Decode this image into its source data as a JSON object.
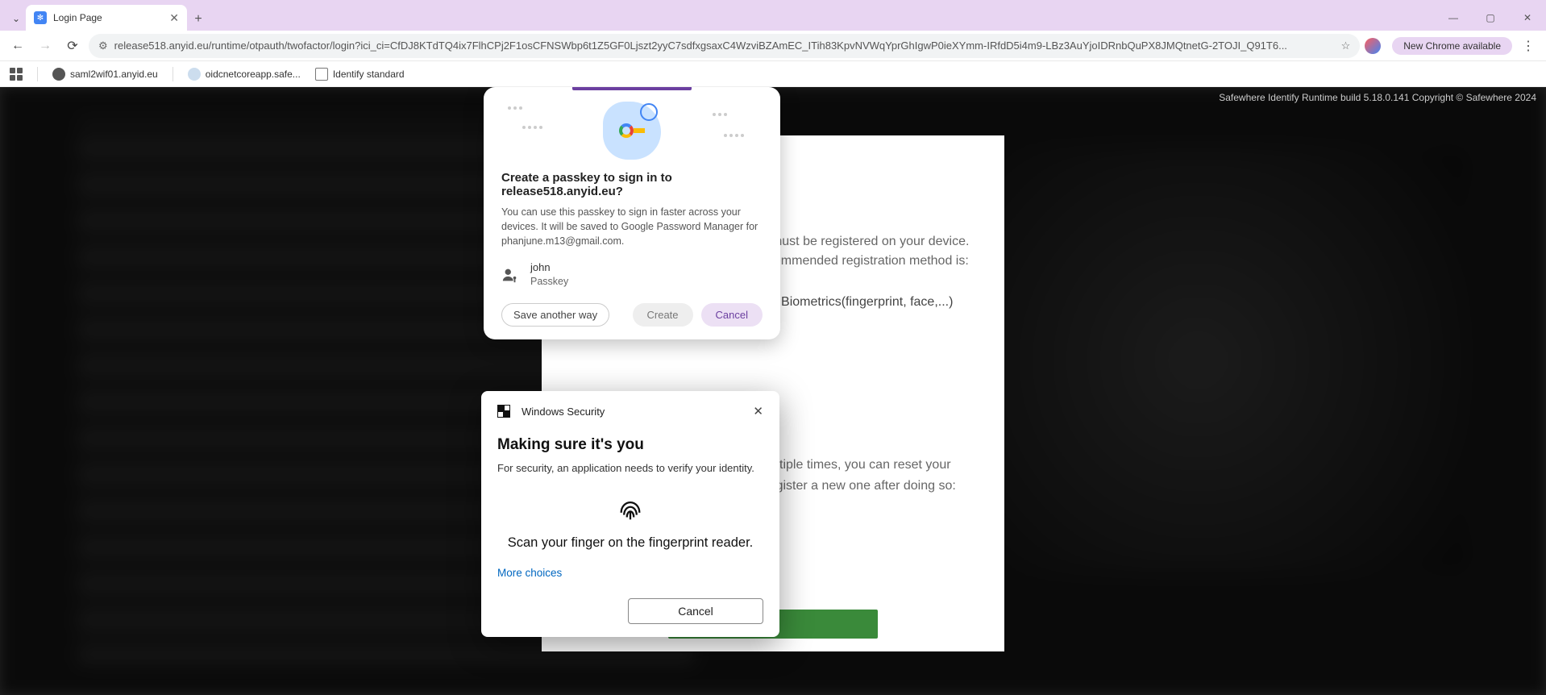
{
  "browser": {
    "tab_title": "Login Page",
    "url": "release518.anyid.eu/runtime/otpauth/twofactor/login?ici_ci=CfDJ8KTdTQ4ix7FlhCPj2F1osCFNSWbp6t1Z5GF0Ljszt2yyC7sdfxgsaxC4WzviBZAmEC_ITih83KpvNVWqYprGhIgwP0ieXYmm-IRfdD5i4m9-LBz3AuYjoIDRnbQuPX8JMQtnetG-2TOJI_Q91T6...",
    "update_label": "New Chrome available",
    "window": {
      "min": "—",
      "max": "▢",
      "close": "✕"
    }
  },
  "bookmarks": {
    "b1": "saml2wif01.anyid.eu",
    "b2": "oidcnetcoreapp.safe...",
    "b3": "Identify standard"
  },
  "page": {
    "runtime": "Safewhere Identify Runtime build 5.18.0.141 Copyright © Safewhere 2024",
    "line1": "Your second factor authentication must be registered on your device.",
    "line2": "Depending on your device, the recommended registration method is:",
    "hint": "Using an android smartphone -> Biometrics(fingerprint, face,...)",
    "reset1": "If the authentication is failed multiple times, you can reset your",
    "reset2": "authenticator. You will need to register a new one after doing so:"
  },
  "passkey": {
    "title": "Create a passkey to sign in to release518.anyid.eu?",
    "desc": "You can use this passkey to sign in faster across your devices. It will be saved to Google Password Manager for phanjune.m13@gmail.com.",
    "user_name": "john",
    "user_type": "Passkey",
    "save_another": "Save another way",
    "create": "Create",
    "cancel": "Cancel"
  },
  "winsec": {
    "header": "Windows Security",
    "title": "Making sure it's you",
    "desc": "For security, an application needs to verify your identity.",
    "scan": "Scan your finger on the fingerprint reader.",
    "more": "More choices",
    "cancel": "Cancel"
  }
}
